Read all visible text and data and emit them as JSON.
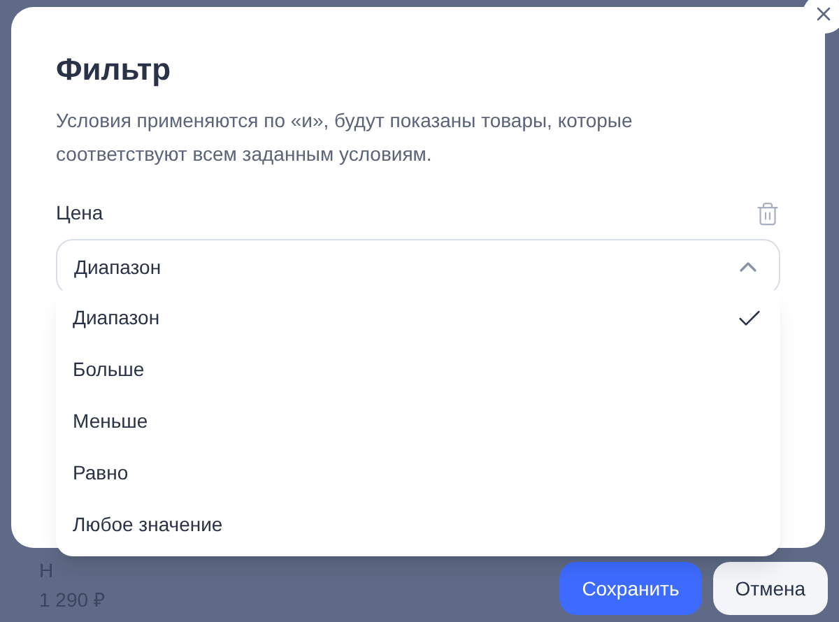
{
  "background": {
    "partial_label": "Н",
    "price": "1 290 ₽",
    "buttons": [
      {
        "label": "Сохранить",
        "kind": "primary"
      },
      {
        "label": "Отмена",
        "kind": "secondary"
      }
    ]
  },
  "dialog": {
    "title": "Фильтр",
    "description": "Условия применяются по «и», будут показаны товары, которые соответствуют всем заданным условиям.",
    "condition": {
      "label": "Цена",
      "select": {
        "value": "Диапазон",
        "expanded": true,
        "options": [
          {
            "label": "Диапазон",
            "selected": true
          },
          {
            "label": "Больше",
            "selected": false
          },
          {
            "label": "Меньше",
            "selected": false
          },
          {
            "label": "Равно",
            "selected": false
          },
          {
            "label": "Любое значение",
            "selected": false
          }
        ]
      }
    }
  }
}
